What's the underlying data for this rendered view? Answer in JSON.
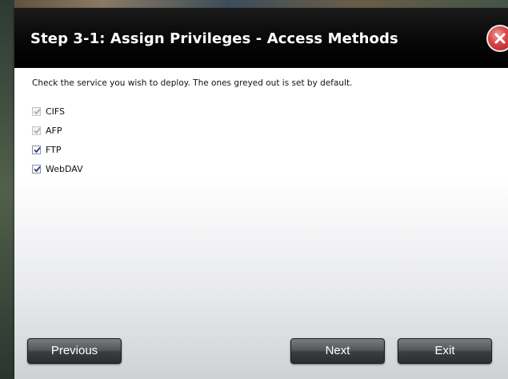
{
  "dialog": {
    "title": "Step 3-1: Assign Privileges - Access Methods",
    "instructions": "Check the service you wish to deploy. The ones greyed out is set by default."
  },
  "services": [
    {
      "label": "CIFS",
      "checked": true,
      "disabled": true
    },
    {
      "label": "AFP",
      "checked": true,
      "disabled": true
    },
    {
      "label": "FTP",
      "checked": true,
      "disabled": false
    },
    {
      "label": "WebDAV",
      "checked": true,
      "disabled": false
    }
  ],
  "buttons": {
    "previous": "Previous",
    "next": "Next",
    "exit": "Exit"
  },
  "icons": {
    "close": "close-icon",
    "checkmark": "checkmark-icon"
  },
  "colors": {
    "titlebar": "#000000",
    "close_button": "#d84a4a",
    "button_dark": "#3a3c3e"
  }
}
